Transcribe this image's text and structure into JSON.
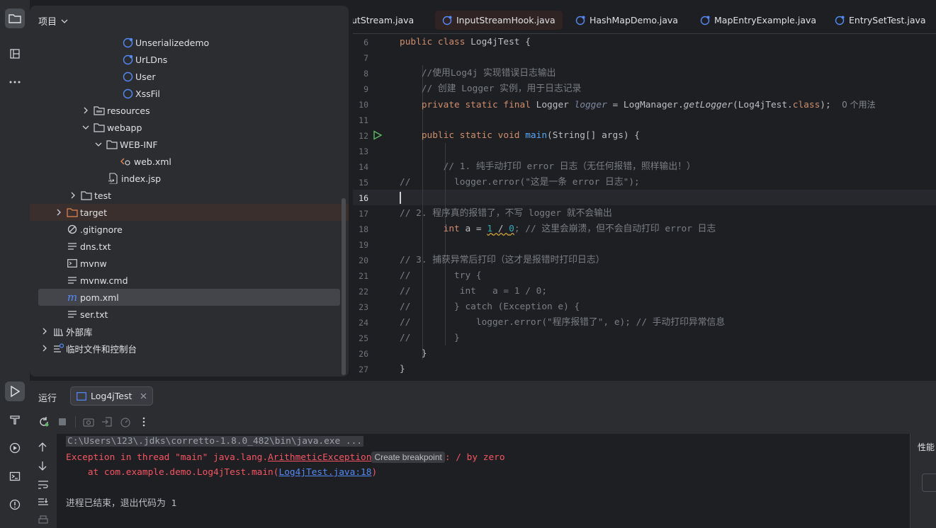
{
  "sidebar_strip": {
    "top_icons": [
      "folder-icon",
      "structure-icon",
      "more-icon"
    ],
    "bottom_icons": [
      "run-icon",
      "build-icon",
      "services-icon",
      "terminal-icon",
      "problems-icon"
    ]
  },
  "project": {
    "title": "项目",
    "tree": [
      {
        "label": "Unserializedemo",
        "icon": "java-class-icon"
      },
      {
        "label": "UrLDns",
        "icon": "java-class-icon"
      },
      {
        "label": "User",
        "icon": "java-class-icon"
      },
      {
        "label": "XssFil",
        "icon": "java-class-icon"
      },
      {
        "label": "resources",
        "icon": "folder-icon"
      },
      {
        "label": "webapp",
        "icon": "folder-icon"
      },
      {
        "label": "WEB-INF",
        "icon": "folder-icon"
      },
      {
        "label": "web.xml",
        "icon": "xml-icon"
      },
      {
        "label": "index.jsp",
        "icon": "jsp-icon"
      },
      {
        "label": "test",
        "icon": "folder-icon"
      },
      {
        "label": "target",
        "icon": "folder-icon"
      },
      {
        "label": ".gitignore",
        "icon": "gitignore-icon"
      },
      {
        "label": "dns.txt",
        "icon": "text-file-icon"
      },
      {
        "label": "mvnw",
        "icon": "shell-icon"
      },
      {
        "label": "mvnw.cmd",
        "icon": "text-file-icon"
      },
      {
        "label": "pom.xml",
        "icon": "maven-icon"
      },
      {
        "label": "ser.txt",
        "icon": "text-file-icon"
      },
      {
        "label": "外部库",
        "icon": "library-icon"
      },
      {
        "label": "临时文件和控制台",
        "icon": "scratch-icon"
      }
    ]
  },
  "editor": {
    "tabs": [
      {
        "label": "utStream.java"
      },
      {
        "label": "InputStreamHook.java"
      },
      {
        "label": "HashMapDemo.java"
      },
      {
        "label": "MapEntryExample.java"
      },
      {
        "label": "EntrySetTest.java"
      }
    ],
    "line_numbers": [
      "6",
      "7",
      "8",
      "9",
      "10",
      "11",
      "12",
      "13",
      "14",
      "15",
      "16",
      "17",
      "18",
      "19",
      "20",
      "21",
      "22",
      "23",
      "24",
      "25",
      "26",
      "27"
    ],
    "code": {
      "l6_kw": "public class ",
      "l6_rest": "Log4jTest {",
      "l8": "    //使用Log4j 实现错误日志输出",
      "l9": "    // 创建 Logger 实例，用于日志记录",
      "l10_kw": "    private static final ",
      "l10_type": "Logger ",
      "l10_field": "logger",
      "l10_mid": " = LogManager.",
      "l10_call": "getLogger",
      "l10_arg": "(Log4jTest.",
      "l10_cls": "class",
      "l10_end": ");",
      "l10_hint": "0 个用法",
      "l12_kw": "    public static void ",
      "l12_fn": "main",
      "l12_rest": "(String[] args) {",
      "l14": "        // 1. 纯手动打印 error 日志（无任何报错，照样输出！）",
      "l15": "//        logger.error(\"这是一条 error 日志\");",
      "l17": "// 2. 程序真的报错了，不写 logger 就不会输出",
      "l18_kw": "        int ",
      "l18_var": "a = ",
      "l18_n1": "1",
      "l18_op": " / ",
      "l18_n2": "0",
      "l18_cm": "; // 这里会崩溃，但不会自动打印 error 日志",
      "l20": "// 3. 捕获异常后打印（这才是报错时打印日志）",
      "l21": "//        try {",
      "l22": "//         int   a = 1 / 0;",
      "l23": "//        } catch (Exception e) {",
      "l24": "//            logger.error(\"程序报错了\", e); // 手动打印异常信息",
      "l25": "//        }",
      "l26": "    }",
      "l27": "}"
    }
  },
  "run": {
    "title": "运行",
    "tab_label": "Log4jTest",
    "console": {
      "cmd": "C:\\Users\\123\\.jdks\\corretto-1.8.0_482\\bin\\java.exe ...",
      "exc_prefix": "Exception in thread \"main\" java.lang.",
      "exc_class": "ArithmeticException",
      "breakpoint_label": "Create breakpoint",
      "exc_suffix": ": / by zero",
      "at_prefix": "    at com.example.demo.Log4jTest.main(",
      "at_link": "Log4jTest.java:18",
      "at_suffix": ")",
      "exit": "进程已结束，退出代码为 1"
    },
    "perf_label": "性能"
  }
}
